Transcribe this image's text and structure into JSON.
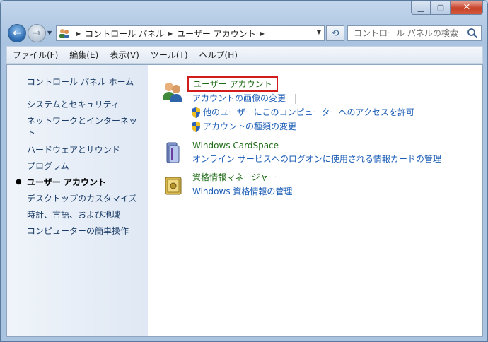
{
  "address": {
    "crumbs": [
      "コントロール パネル",
      "ユーザー アカウント"
    ]
  },
  "search": {
    "placeholder": "コントロール パネルの検索"
  },
  "menu": [
    "ファイル(F)",
    "編集(E)",
    "表示(V)",
    "ツール(T)",
    "ヘルプ(H)"
  ],
  "sidebar": {
    "home": "コントロール パネル ホーム",
    "items": [
      "システムとセキュリティ",
      "ネットワークとインターネット",
      "ハードウェアとサウンド",
      "プログラム",
      "ユーザー アカウント",
      "デスクトップのカスタマイズ",
      "時計、言語、および地域",
      "コンピューターの簡単操作"
    ],
    "current": "ユーザー アカウント"
  },
  "groups": {
    "user_accounts": {
      "title": "ユーザー アカウント",
      "links": [
        "アカウントの画像の変更",
        "他のユーザーにこのコンピューターへのアクセスを許可",
        "アカウントの種類の変更"
      ]
    },
    "cardspace": {
      "title": "Windows CardSpace",
      "links": [
        "オンライン サービスへのログオンに使用される情報カードの管理"
      ]
    },
    "credential": {
      "title": "資格情報マネージャー",
      "links": [
        "Windows 資格情報の管理"
      ]
    }
  },
  "icons": {
    "back": "back-arrow-icon",
    "forward": "forward-arrow-icon",
    "refresh": "refresh-icon",
    "search": "search-icon",
    "shield": "uac-shield-icon"
  },
  "colors": {
    "link": "#1a5cb5",
    "group_title": "#1e6b16",
    "highlight_box": "#d21b1b"
  }
}
